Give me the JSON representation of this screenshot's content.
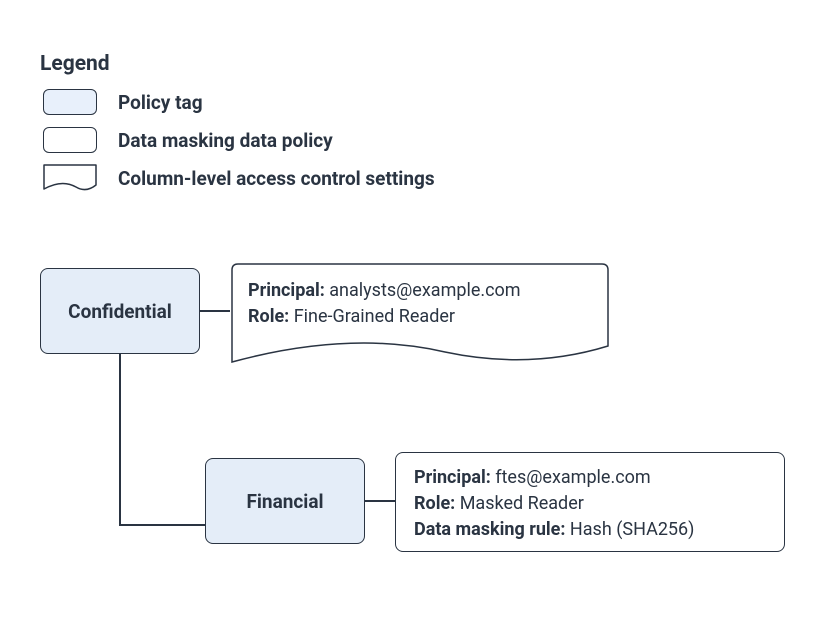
{
  "legend": {
    "title": "Legend",
    "items": [
      {
        "label": "Policy tag"
      },
      {
        "label": "Data masking data policy"
      },
      {
        "label": "Column-level access control settings"
      }
    ]
  },
  "diagram": {
    "confidential": {
      "label": "Confidential",
      "settings": {
        "principal_label": "Principal:",
        "principal_value": "analysts@example.com",
        "role_label": "Role:",
        "role_value": "Fine-Grained Reader"
      }
    },
    "financial": {
      "label": "Financial",
      "policy": {
        "principal_label": "Principal:",
        "principal_value": "ftes@example.com",
        "role_label": "Role:",
        "role_value": "Masked Reader",
        "rule_label": "Data masking rule:",
        "rule_value": "Hash (SHA256)"
      }
    }
  }
}
